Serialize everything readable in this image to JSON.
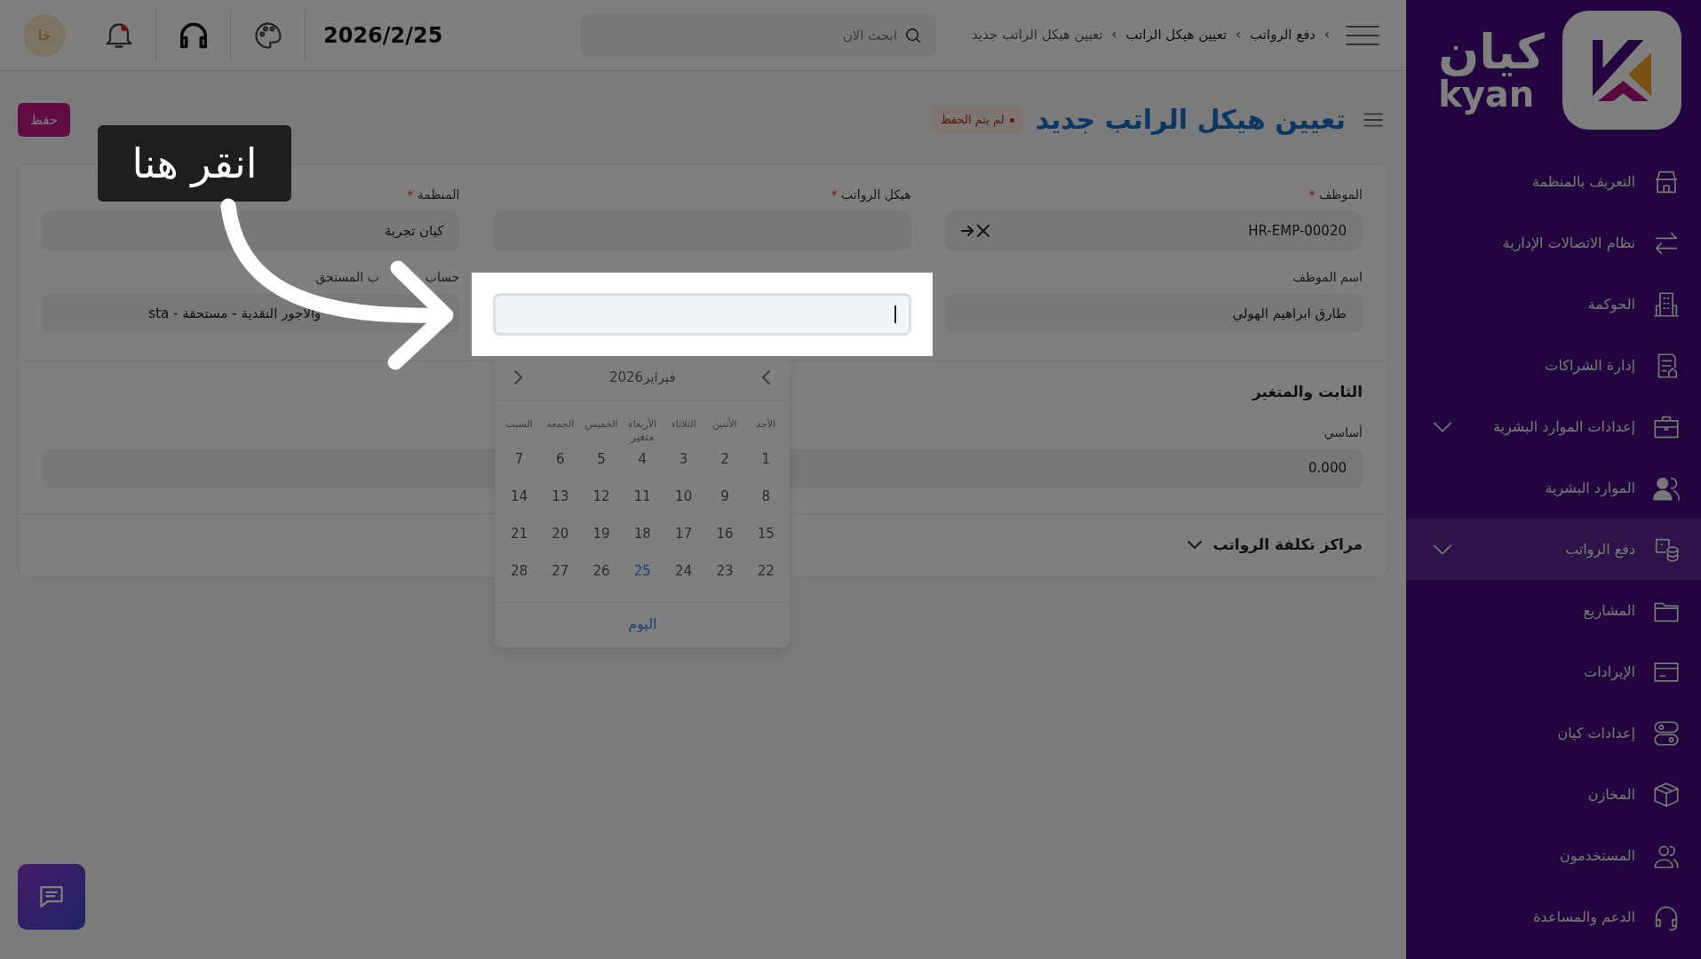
{
  "sidebar": {
    "logo": {
      "arabic": "كيان",
      "latin": "kyan"
    },
    "items": [
      {
        "label": "التعريف بالمنظمة",
        "selected": false,
        "expandable": false
      },
      {
        "label": "نظام الاتصالات الإدارية",
        "selected": false,
        "expandable": false
      },
      {
        "label": "الحوكمة",
        "selected": false,
        "expandable": false
      },
      {
        "label": "إدارة الشراكات",
        "selected": false,
        "expandable": false
      },
      {
        "label": "إعدادات الموارد البشرية",
        "selected": false,
        "expandable": true
      },
      {
        "label": "الموارد البشرية",
        "selected": false,
        "expandable": false
      },
      {
        "label": "دفع الرواتب",
        "selected": true,
        "expandable": true
      },
      {
        "label": "المشاريع",
        "selected": false,
        "expandable": false
      },
      {
        "label": "الإيرادات",
        "selected": false,
        "expandable": false
      },
      {
        "label": "إعدادات كيان",
        "selected": false,
        "expandable": false
      },
      {
        "label": "المخازن",
        "selected": false,
        "expandable": false
      },
      {
        "label": "المستخدمون",
        "selected": false,
        "expandable": false
      },
      {
        "label": "الدعم والمساعدة",
        "selected": false,
        "expandable": false
      }
    ]
  },
  "topbar": {
    "separator": "›",
    "breadcrumbs": [
      {
        "label": "دفع الرواتب",
        "current": false
      },
      {
        "label": "تعيين هيكل الراتب",
        "current": false
      },
      {
        "label": "تعيين هيكل الراتب جديد",
        "current": true
      }
    ],
    "search": {
      "placeholder": "ابحث الان"
    },
    "date": "2026/2/25",
    "notification_dot": true,
    "avatar": "خا"
  },
  "page": {
    "title": "تعيين هيكل الراتب جديد",
    "status": "لم يتم الحفظ",
    "save_button": "حفظ"
  },
  "form": {
    "required_mark": "*",
    "fields": [
      {
        "kind": "link",
        "label": "الموظف",
        "required": true,
        "value": "HR-EMP-00020"
      },
      {
        "kind": "text",
        "label": "هيكل الرواتب",
        "required": true
      },
      {
        "kind": "text",
        "label": "المنظمة",
        "required": true,
        "value": "كيان تجربة"
      },
      {
        "kind": "text",
        "label": "اسم الموظف",
        "required": false,
        "value": "طارق ابراهيم الهولي"
      },
      {
        "kind": "date"
      },
      {
        "kind": "obscured",
        "label_parts": [
          "حساب",
          "ب المستحق"
        ],
        "value": "والاجور النقدية - مستحقة - sta"
      }
    ]
  },
  "sections": [
    {
      "title": "الثابت والمتغير",
      "collapsible": false,
      "fields": [
        {
          "label": "أساسي",
          "value": "0.000"
        }
      ],
      "overlap_label": "متغير"
    },
    {
      "title": "مراكز تكلفة الرواتب",
      "collapsible": true
    }
  ],
  "datepicker": {
    "month": "فبراير",
    "year": "2026",
    "weekdays": [
      "الأحد",
      "الأثنين",
      "الثلاثاء",
      "الأربعاء",
      "الخميس",
      "الجمعه",
      "السبت"
    ],
    "weeks": [
      [
        {
          "day": "1",
          "today": false
        },
        {
          "day": "2",
          "today": false
        },
        {
          "day": "3",
          "today": false
        },
        {
          "day": "4",
          "today": false
        },
        {
          "day": "5",
          "today": false
        },
        {
          "day": "6",
          "today": false
        },
        {
          "day": "7",
          "today": false
        }
      ],
      [
        {
          "day": "8",
          "today": false
        },
        {
          "day": "9",
          "today": false
        },
        {
          "day": "10",
          "today": false
        },
        {
          "day": "11",
          "today": false
        },
        {
          "day": "12",
          "today": false
        },
        {
          "day": "13",
          "today": false
        },
        {
          "day": "14",
          "today": false
        }
      ],
      [
        {
          "day": "15",
          "today": false
        },
        {
          "day": "16",
          "today": false
        },
        {
          "day": "17",
          "today": false
        },
        {
          "day": "18",
          "today": false
        },
        {
          "day": "19",
          "today": false
        },
        {
          "day": "20",
          "today": false
        },
        {
          "day": "21",
          "today": false
        }
      ],
      [
        {
          "day": "22",
          "today": false
        },
        {
          "day": "23",
          "today": false
        },
        {
          "day": "24",
          "today": false
        },
        {
          "day": "25",
          "today": true
        },
        {
          "day": "26",
          "today": false
        },
        {
          "day": "27",
          "today": false
        },
        {
          "day": "28",
          "today": false
        }
      ]
    ],
    "today_button": "اليوم"
  },
  "tour": {
    "tooltip": "انقر هنا"
  }
}
